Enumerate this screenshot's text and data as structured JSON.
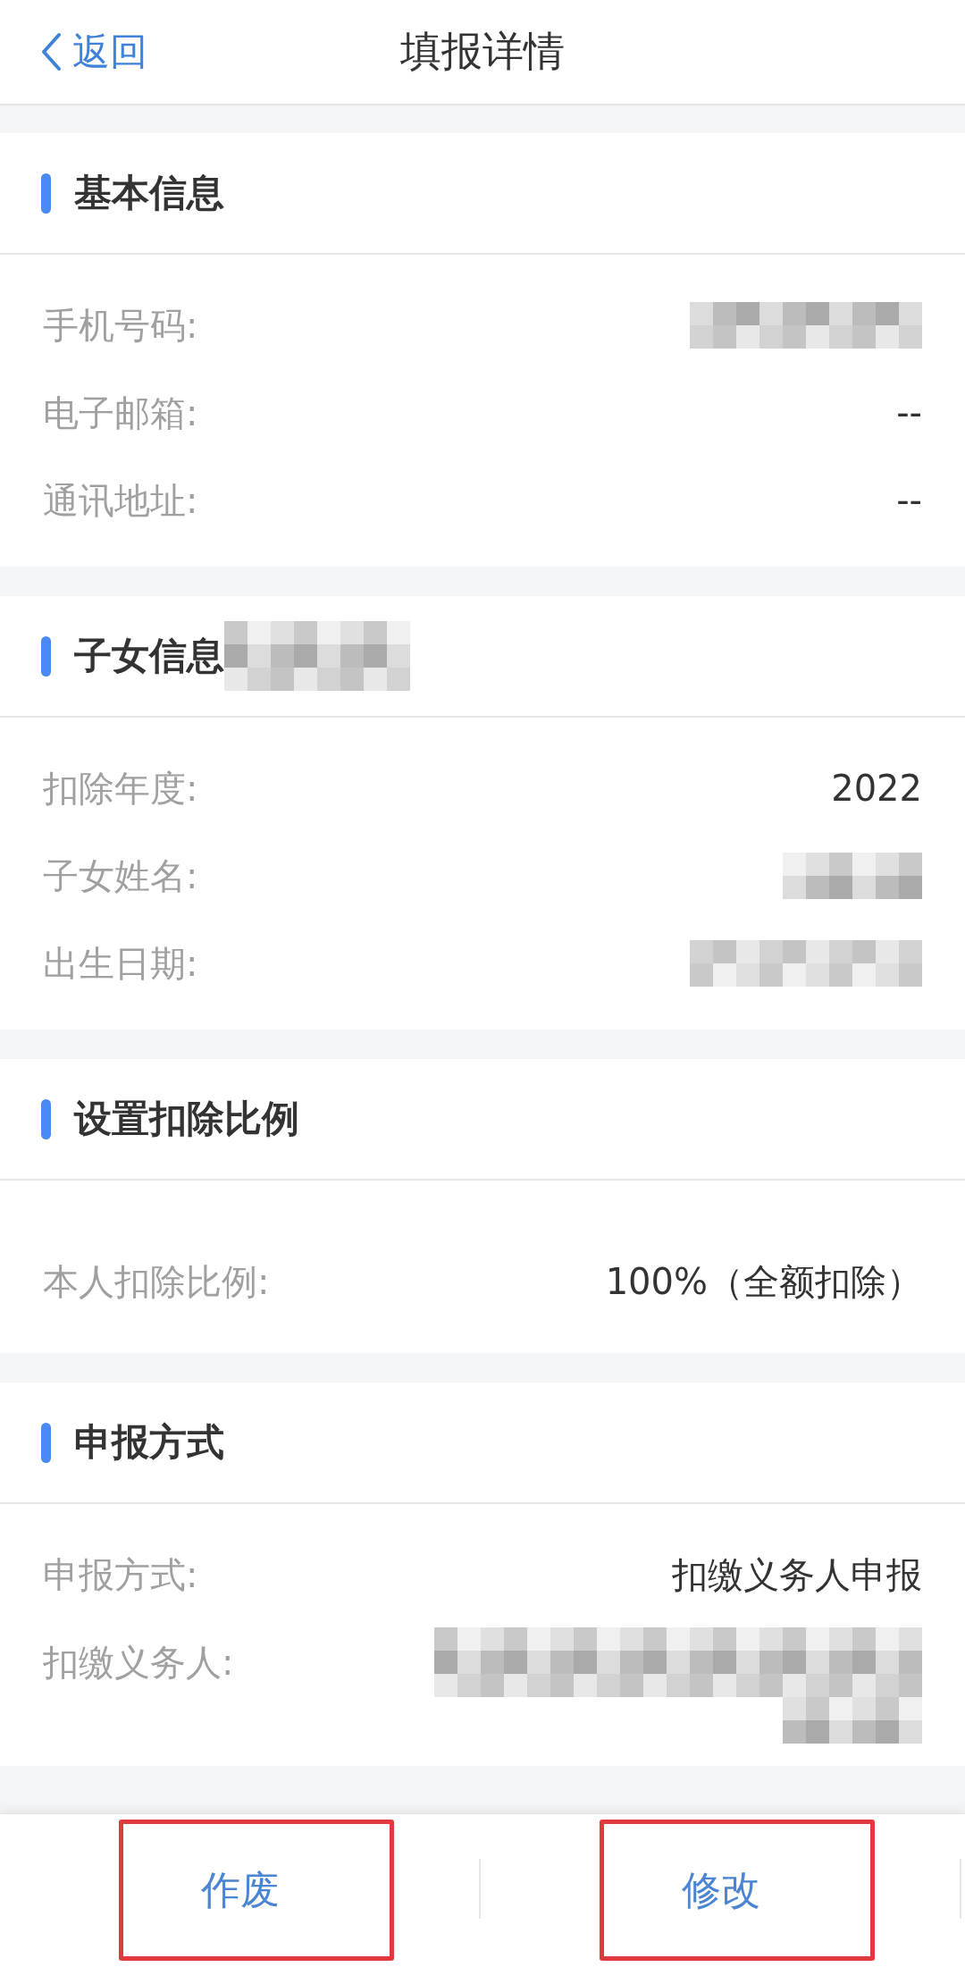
{
  "header": {
    "back": {
      "label": "返回"
    },
    "title": "填报详情"
  },
  "sections": [
    {
      "title": "基本信息",
      "title_redacted": false,
      "rows": [
        {
          "label": "手机号码:",
          "kind": "redacted"
        },
        {
          "label": "电子邮箱:",
          "kind": "text",
          "value": "--"
        },
        {
          "label": "通讯地址:",
          "kind": "text",
          "value": "--"
        }
      ]
    },
    {
      "title": "子女信息",
      "title_redacted": true,
      "rows": [
        {
          "label": "扣除年度:",
          "kind": "text",
          "value": "2022"
        },
        {
          "label": "子女姓名:",
          "kind": "redacted"
        },
        {
          "label": "出生日期:",
          "kind": "redacted"
        }
      ]
    },
    {
      "title": "设置扣除比例",
      "title_redacted": false,
      "rows": [
        {
          "label": "本人扣除比例:",
          "kind": "text",
          "value": "100%（全额扣除）"
        }
      ]
    },
    {
      "title": "申报方式",
      "title_redacted": false,
      "rows": [
        {
          "label": "申报方式:",
          "kind": "text",
          "value": "扣缴义务人申报"
        },
        {
          "label": "扣缴义务人:",
          "kind": "redacted"
        }
      ]
    }
  ],
  "actions": [
    {
      "label": "作废",
      "highlighted": true
    },
    {
      "label": "修改",
      "highlighted": true
    }
  ]
}
